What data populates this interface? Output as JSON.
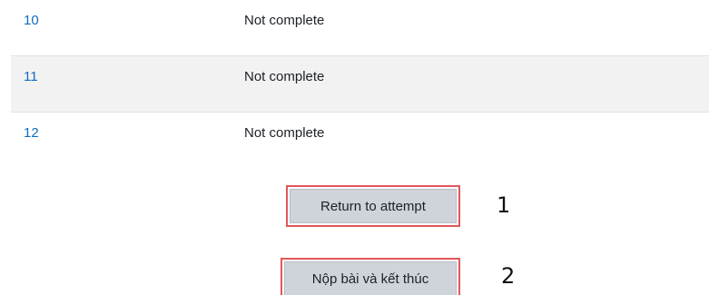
{
  "summary": {
    "rows": [
      {
        "question": "10",
        "status": "Not complete"
      },
      {
        "question": "11",
        "status": "Not complete"
      },
      {
        "question": "12",
        "status": "Not complete"
      }
    ]
  },
  "actions": {
    "return_label": "Return to attempt",
    "submit_label": "Nộp bài và kết thúc"
  },
  "annotations": {
    "marker_1": "1",
    "marker_2": "2",
    "highlight_color": "#e0575a"
  },
  "colors": {
    "link": "#0f6cbf",
    "stripe": "#f2f2f2",
    "button": "#ced4da"
  }
}
